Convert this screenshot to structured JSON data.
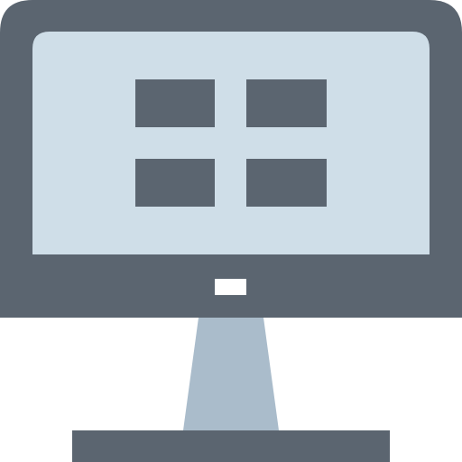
{
  "icon": {
    "name": "desktop-computer-icon",
    "colors": {
      "frame": "#5b6570",
      "screen": "#cfdee8",
      "stand": "#aabccb",
      "indicator": "#ffffff",
      "tiles": "#5b6570"
    }
  }
}
